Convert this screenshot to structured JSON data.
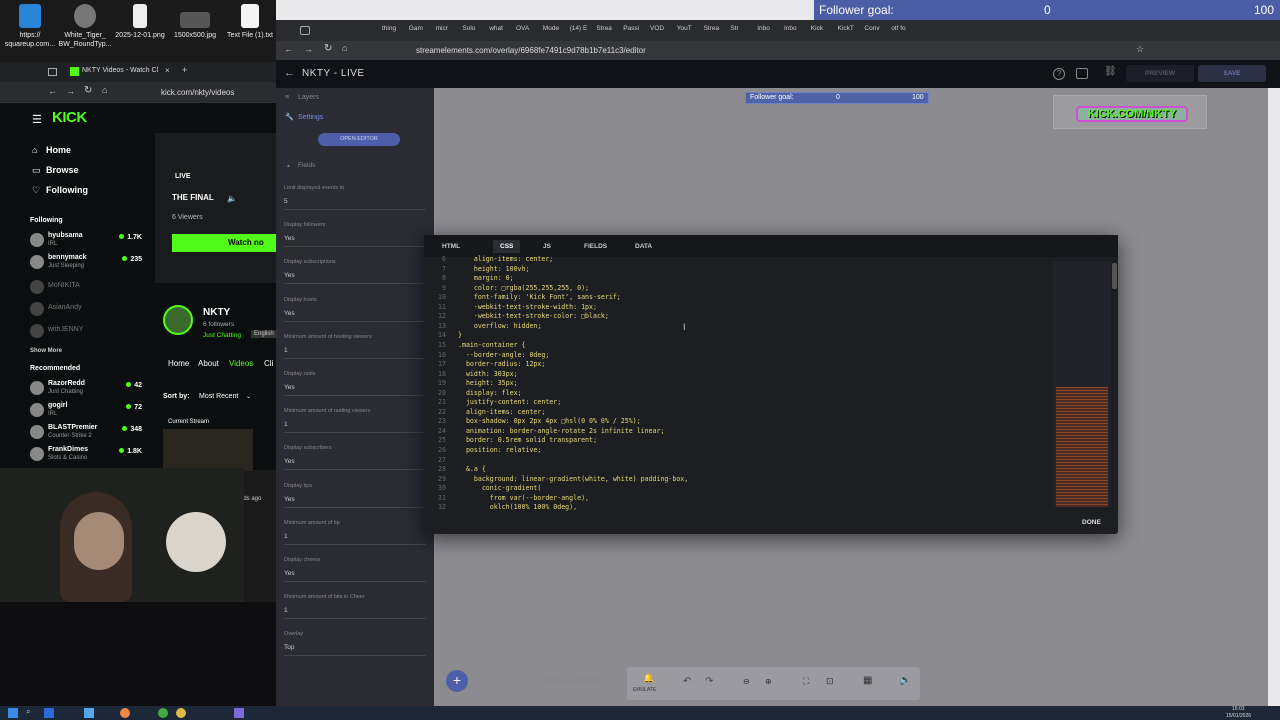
{
  "desktop_icons": [
    {
      "label": "https://\nsquareup.com...",
      "color": "#2a84d6"
    },
    {
      "label": "White_Tiger_\nBW_RoundTyp...",
      "color": "#777"
    },
    {
      "label": "2025-12-01.png",
      "color": "#eee"
    },
    {
      "label": "1500x500.jpg",
      "color": "#444"
    },
    {
      "label": "Text File (1).txt",
      "color": "#f4f4f4"
    }
  ],
  "follower_goal_overlay": {
    "label": "Follower goal:",
    "current": "0",
    "target": "100"
  },
  "se_tabs": [
    "thing",
    "Gam",
    "micr",
    "Solo",
    "what",
    "OVA",
    "Mode",
    "(14) E",
    "Strea",
    "Passi",
    "VOD",
    "YouT",
    "Strea",
    "Str",
    "Inbo",
    "Inbo",
    "Kick",
    "KickT",
    "Conv",
    "otf fo"
  ],
  "se_address": "streamelements.com/overlay/6968fe7491c9d78b1b7e11c3/editor",
  "se_header": {
    "title": "NKTY - LIVE",
    "preview": "PREVIEW",
    "save": "SAVE"
  },
  "se_left": {
    "layers": "Layers",
    "settings": "Settings",
    "open_editor": "OPEN EDITOR",
    "fields": "Fields",
    "field_rows": [
      {
        "label": "Limit displayed events to",
        "value": "5"
      },
      {
        "label": "Display followers",
        "value": "Yes"
      },
      {
        "label": "Display subscriptions",
        "value": "Yes"
      },
      {
        "label": "Display hosts",
        "value": "Yes"
      },
      {
        "label": "Minimum amount of hosting viewers",
        "value": "1"
      },
      {
        "label": "Display raids",
        "value": "Yes"
      },
      {
        "label": "Minimum amount of raiding viewers",
        "value": "1"
      },
      {
        "label": "Display subscribers",
        "value": "Yes"
      },
      {
        "label": "Display tips",
        "value": "Yes"
      },
      {
        "label": "Minimum amount of tip",
        "value": "1"
      },
      {
        "label": "Display cheers",
        "value": "Yes"
      },
      {
        "label": "Minimum amount of bits in Cheer",
        "value": "1"
      },
      {
        "label": "Overlay",
        "value": "Top"
      }
    ]
  },
  "canvas_goal": {
    "label": "Follower goal:",
    "current": "0",
    "target": "100"
  },
  "kick_banner": "KICK.COM/NKTY",
  "editor": {
    "tabs": [
      "HTML",
      "CSS",
      "JS",
      "FIELDS",
      "DATA"
    ],
    "active_tab": "CSS",
    "done": "DONE",
    "lines": [
      {
        "n": "6",
        "t": "    align-items: center;"
      },
      {
        "n": "7",
        "t": "    height: 100vh;"
      },
      {
        "n": "8",
        "t": "    margin: 0;"
      },
      {
        "n": "9",
        "t": "    color: □rgba(255,255,255, 0);"
      },
      {
        "n": "10",
        "t": "    font-family: 'Kick Font', sans-serif;"
      },
      {
        "n": "11",
        "t": "    -webkit-text-stroke-width: 1px;"
      },
      {
        "n": "12",
        "t": "    -webkit-text-stroke-color: □black;"
      },
      {
        "n": "13",
        "t": "    overflow: hidden;"
      },
      {
        "n": "14",
        "t": "}"
      },
      {
        "n": "15",
        "t": ".main-container {"
      },
      {
        "n": "16",
        "t": "  --border-angle: 0deg;"
      },
      {
        "n": "17",
        "t": "  border-radius: 12px;"
      },
      {
        "n": "18",
        "t": "  width: 303px;"
      },
      {
        "n": "19",
        "t": "  height: 35px;"
      },
      {
        "n": "20",
        "t": "  display: flex;"
      },
      {
        "n": "21",
        "t": "  justify-content: center;"
      },
      {
        "n": "22",
        "t": "  align-items: center;"
      },
      {
        "n": "23",
        "t": "  box-shadow: 0px 2px 4px □hsl(0 0% 0% / 25%);"
      },
      {
        "n": "24",
        "t": "  animation: border-angle-rotate 2s infinite linear;"
      },
      {
        "n": "25",
        "t": "  border: 0.5rem solid transparent;"
      },
      {
        "n": "26",
        "t": "  position: relative;"
      },
      {
        "n": "27",
        "t": ""
      },
      {
        "n": "28",
        "t": "  &.a {"
      },
      {
        "n": "29",
        "t": "    background: linear-gradient(white, white) padding-box,"
      },
      {
        "n": "30",
        "t": "      conic-gradient("
      },
      {
        "n": "31",
        "t": "        from var(--border-angle),"
      },
      {
        "n": "32",
        "t": "        oklch(100% 100% 0deg),"
      }
    ]
  },
  "bottom_toolbar": {
    "add": "+",
    "hint": "Move a widget",
    "emulate": "EMULATE"
  },
  "kick": {
    "tab_title": "NKTY Videos - Watch Cl",
    "address": "kick.com/nkty/videos",
    "logo": "KICK",
    "nav": [
      "Home",
      "Browse",
      "Following"
    ],
    "following_header": "Following",
    "following": [
      {
        "name": "hyubsama",
        "sub": "IRL",
        "count": "1.7K"
      },
      {
        "name": "bennymack",
        "sub": "Just Sleeping",
        "count": "235"
      }
    ],
    "offline": [
      "MoNIKITA",
      "AsianAndy",
      "withJENNY"
    ],
    "show_more": "Show More",
    "recommended_header": "Recommended",
    "recommended": [
      {
        "name": "RazorRedd",
        "sub": "Just Chatting",
        "count": "42"
      },
      {
        "name": "gogirl",
        "sub": "IRL",
        "count": "72"
      },
      {
        "name": "BLASTPremier",
        "sub": "Counter-Strike 2",
        "count": "348"
      },
      {
        "name": "FrankDimes",
        "sub": "Slots & Casino",
        "count": "1.8K"
      }
    ],
    "live_badge": "LIVE",
    "stream_title": "THE FINAL",
    "viewers": "6 Viewers",
    "watch_now": "Watch no",
    "channel": {
      "name": "NKTY",
      "followers": "6 followers",
      "category": "Just Chatting",
      "lang": "English"
    },
    "channel_tabs": [
      "Home",
      "About",
      "Videos",
      "Cli"
    ],
    "sort_label": "Sort by:",
    "sort_value": "Most Recent",
    "current_stream": "Current Stream",
    "ago": "nds ago"
  },
  "clock": {
    "time": "16:03",
    "date": "15/01/2026"
  }
}
